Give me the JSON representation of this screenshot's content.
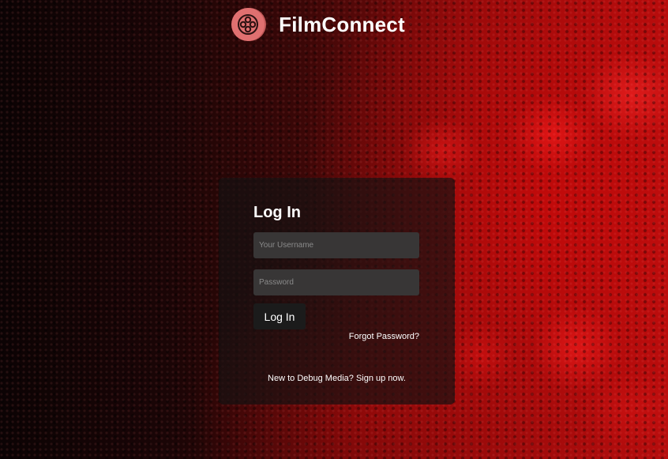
{
  "header": {
    "brand": "FilmConnect",
    "logo_icon": "film-reel-icon"
  },
  "login": {
    "title": "Log In",
    "username_placeholder": "Your Username",
    "password_placeholder": "Password",
    "submit_label": "Log In",
    "forgot_link": "Forgot Password?",
    "signup_text": "New to Debug Media? Sign up now."
  },
  "colors": {
    "logo": "#e07070",
    "card_bg": "#141212",
    "field_bg": "#383636",
    "background_accent": "#b50d0d"
  }
}
